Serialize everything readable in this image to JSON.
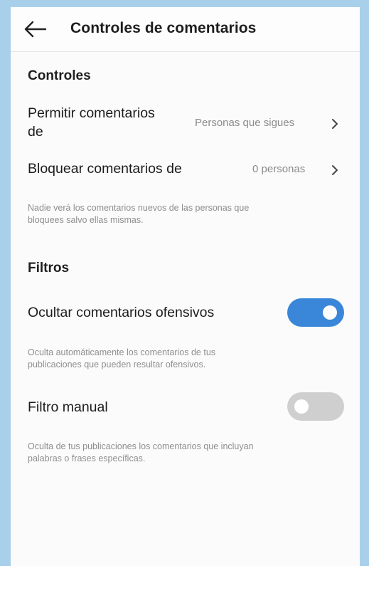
{
  "header": {
    "title": "Controles de comentarios",
    "back_icon": "arrow-left-icon"
  },
  "controls": {
    "section_title": "Controles",
    "allow_comments": {
      "label_line1": "Permitir comentarios",
      "label_line2": "de",
      "value": "Personas que sigues"
    },
    "block_comments": {
      "label": "Bloquear comentarios de",
      "value": "0 personas"
    },
    "helper_line1": "Nadie verá los comentarios nuevos de las personas que",
    "helper_line2": "bloquees salvo ellas mismas."
  },
  "filters": {
    "section_title": "Filtros",
    "hide_offensive": {
      "label": "Ocultar comentarios ofensivos",
      "enabled": true,
      "helper_line1": "Oculta automáticamente los comentarios de tus",
      "helper_line2": "publicaciones que pueden resultar ofensivos."
    },
    "manual_filter": {
      "label": "Filtro manual",
      "enabled": false,
      "helper_line1": "Oculta de tus publicaciones los comentarios que incluyan",
      "helper_line2": "palabras o frases específicas."
    }
  },
  "colors": {
    "toggle_on": "#3a86d8",
    "toggle_off": "#cfcfcf",
    "border_accent": "#a9d0ea"
  }
}
